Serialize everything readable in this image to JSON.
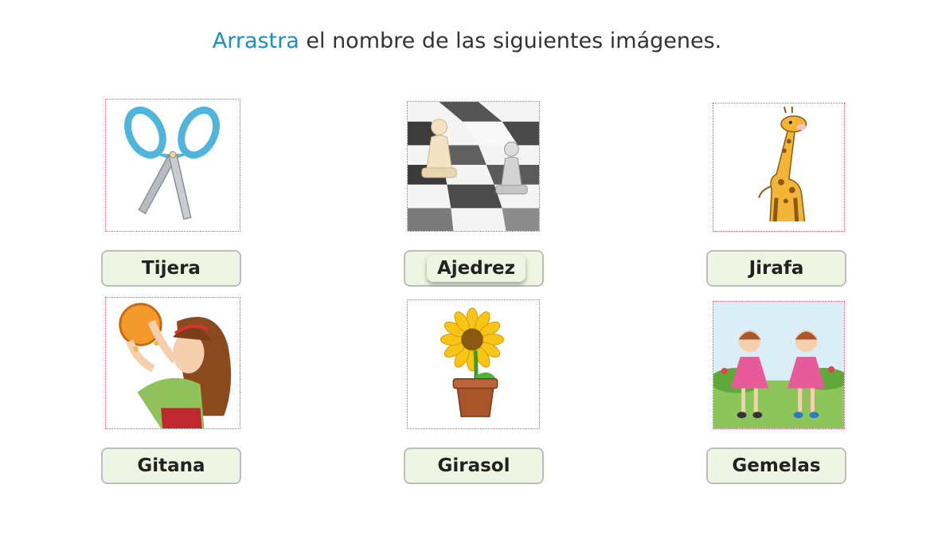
{
  "instruction": {
    "highlight": "Arrastra",
    "rest": " el nombre de las siguientes imágenes."
  },
  "items": [
    {
      "word": "Tijera",
      "image": "scissors-icon"
    },
    {
      "word": "Ajedrez",
      "image": "chess-pawns-icon"
    },
    {
      "word": "Jirafa",
      "image": "giraffe-icon"
    },
    {
      "word": "Gitana",
      "image": "gypsy-girl-tambourine-icon"
    },
    {
      "word": "Girasol",
      "image": "sunflower-pot-icon"
    },
    {
      "word": "Gemelas",
      "image": "twin-girls-icon"
    }
  ],
  "colors": {
    "accent": "#1a8fc9",
    "slot_bg": "#eef6e3",
    "slot_border": "#bdbdbd",
    "card_border": "#d4607a"
  }
}
